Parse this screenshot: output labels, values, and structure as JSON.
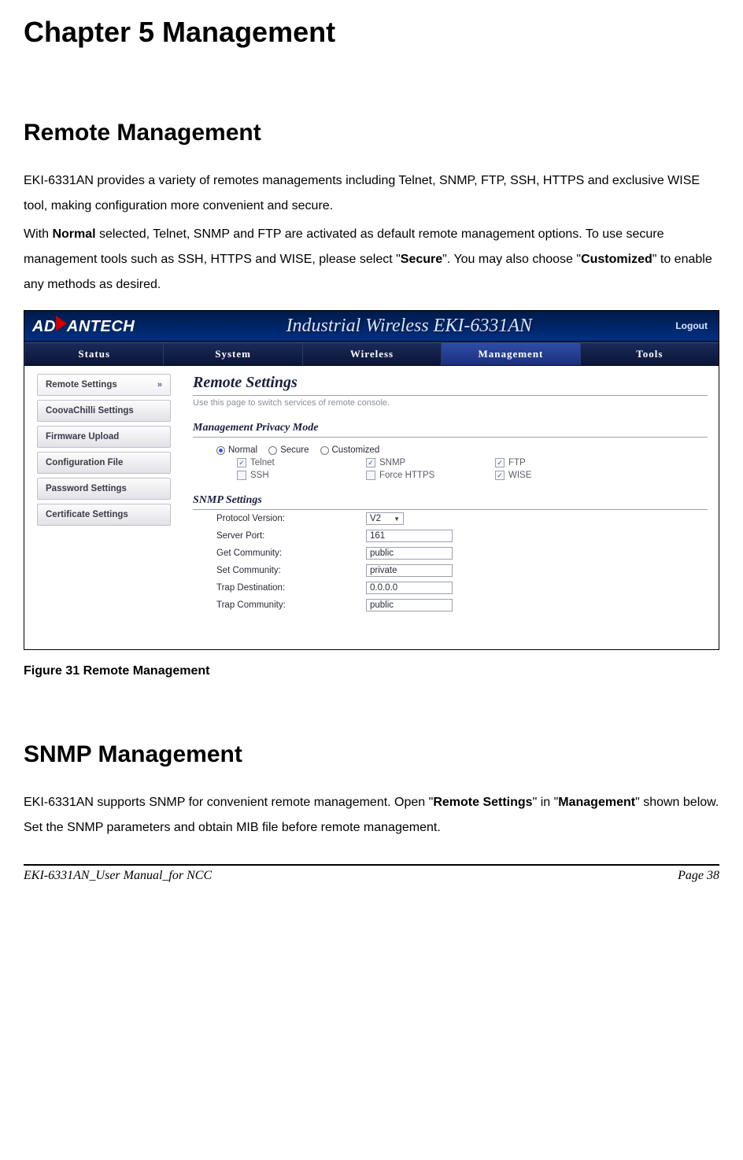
{
  "doc": {
    "chapter_title": "Chapter 5 Management",
    "section1_title": "Remote Management",
    "para1": "EKI-6331AN provides a variety of remotes managements including Telnet, SNMP, FTP, SSH, HTTPS and exclusive WISE tool, making configuration more convenient and secure.",
    "para2a": "With ",
    "para2b": "Normal",
    "para2c": " selected, Telnet, SNMP and FTP are activated as default remote management options. To use secure management tools such as SSH, HTTPS and WISE, please select \"",
    "para2d": "Secure",
    "para2e": "\".    You may also choose \"",
    "para2f": "Customized",
    "para2g": "\" to enable any methods as desired.",
    "figure_caption": "Figure 31 Remote Management",
    "section2_title": "SNMP Management",
    "para3a": "EKI-6331AN supports SNMP for convenient remote management. Open \"",
    "para3b": "Remote Settings",
    "para3c": "\" in \"",
    "para3d": "Management",
    "para3e": "\" shown below. Set the SNMP parameters and obtain MIB file before remote management.",
    "footer_left": "EKI-6331AN_User Manual_for NCC",
    "footer_right": "Page 38"
  },
  "ui": {
    "brand": "ADVANTECH",
    "banner_title": "Industrial Wireless EKI-6331AN",
    "logout": "Logout",
    "tabs": [
      "Status",
      "System",
      "Wireless",
      "Management",
      "Tools"
    ],
    "active_tab": "Management",
    "sidebar": [
      {
        "label": "Remote Settings",
        "active": true
      },
      {
        "label": "CoovaChilli Settings",
        "active": false
      },
      {
        "label": "Firmware Upload",
        "active": false
      },
      {
        "label": "Configuration File",
        "active": false
      },
      {
        "label": "Password Settings",
        "active": false
      },
      {
        "label": "Certificate Settings",
        "active": false
      }
    ],
    "page_title": "Remote Settings",
    "page_sub": "Use this page to switch services of remote console.",
    "mode_hdr": "Management Privacy Mode",
    "modes": [
      {
        "label": "Normal",
        "selected": true
      },
      {
        "label": "Secure",
        "selected": false
      },
      {
        "label": "Customized",
        "selected": false
      }
    ],
    "opts_row1": [
      {
        "label": "Telnet",
        "checked": true
      },
      {
        "label": "SNMP",
        "checked": true
      },
      {
        "label": "FTP",
        "checked": true
      }
    ],
    "opts_row2": [
      {
        "label": "SSH",
        "checked": false
      },
      {
        "label": "Force HTTPS",
        "checked": false
      },
      {
        "label": "WISE",
        "checked": true
      }
    ],
    "snmp_hdr": "SNMP Settings",
    "snmp": {
      "proto_lbl": "Protocol Version:",
      "proto_val": "V2",
      "port_lbl": "Server Port:",
      "port_val": "161",
      "getc_lbl": "Get Community:",
      "getc_val": "public",
      "setc_lbl": "Set Community:",
      "setc_val": "private",
      "trapd_lbl": "Trap Destination:",
      "trapd_val": "0.0.0.0",
      "trapc_lbl": "Trap Community:",
      "trapc_val": "public"
    }
  }
}
